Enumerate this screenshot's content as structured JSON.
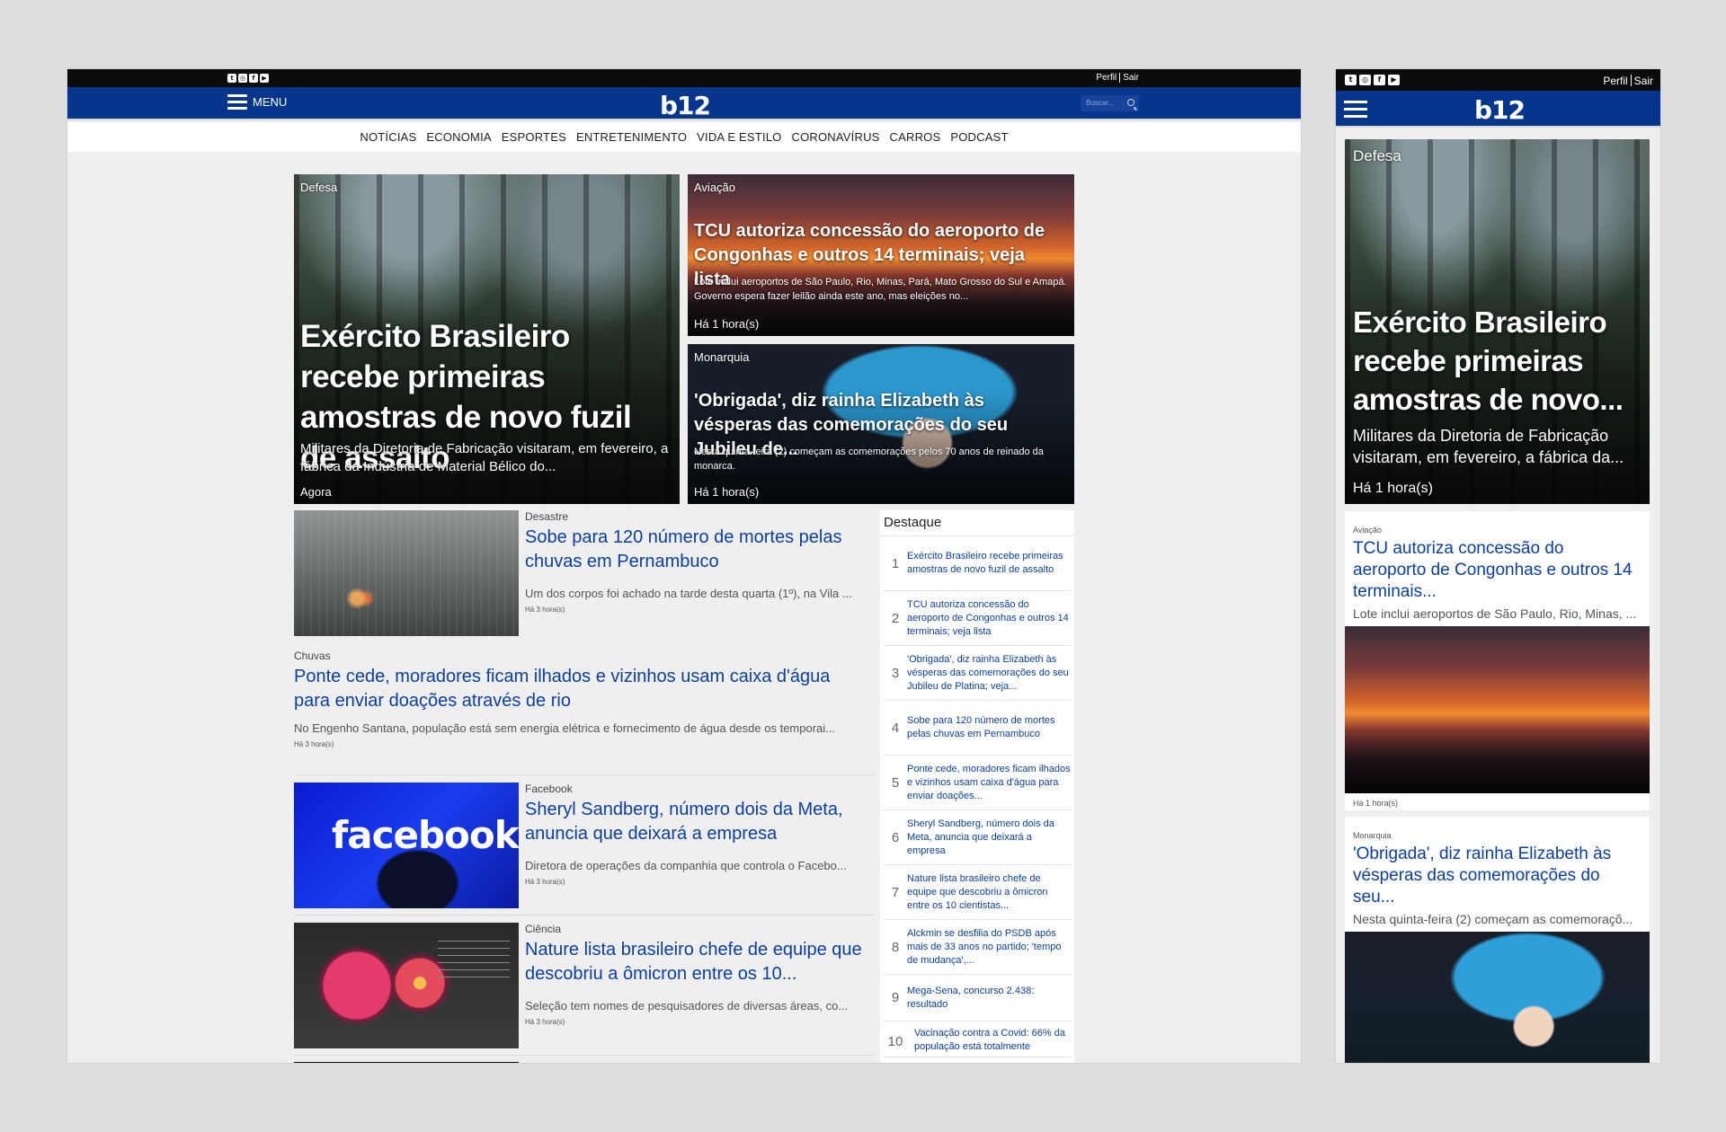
{
  "brand": {
    "logo": "b12"
  },
  "topbar": {
    "social": [
      "twitter-icon",
      "instagram-icon",
      "facebook-icon",
      "youtube-icon"
    ],
    "profile": "Perfil",
    "logout": "Sair"
  },
  "navbar": {
    "menu_label": "MENU",
    "search_placeholder": "Buscar..."
  },
  "categories": [
    "NOTÍCIAS",
    "ECONOMIA",
    "ESPORTES",
    "ENTRETENIMENTO",
    "VIDA E ESTILO",
    "CORONAVÍRUS",
    "CARROS",
    "PODCAST"
  ],
  "hero": {
    "main": {
      "category": "Defesa",
      "title": "Exército Brasileiro recebe primeiras amostras de novo fuzil de assalto",
      "summary": "Militares da Diretoria de Fabricação visitaram, em fevereiro, a fábrica da Indústria de Material Bélico do...",
      "time": "Agora"
    },
    "side1": {
      "category": "Aviação",
      "title": "TCU autoriza concessão do aeroporto de Congonhas e outros 14 terminais; veja lista",
      "summary": "Lote inclui aeroportos de São Paulo, Rio, Minas, Pará, Mato Grosso do Sul e Amapá. Governo espera fazer leilão ainda este ano, mas eleições no...",
      "time": "Há 1 hora(s)"
    },
    "side2": {
      "category": "Monarquia",
      "title": "'Obrigada', diz rainha Elizabeth às vésperas das comemorações do seu Jubileu de...",
      "summary": "Nesta quinta-feira (2) começam as comemorações pelos 70 anos de reinado da monarca.",
      "time": "Há 1 hora(s)"
    }
  },
  "articles": [
    {
      "category": "Desastre",
      "title": "Sobe para 120 número de mortes pelas chuvas em Pernambuco",
      "summary": "Um dos corpos foi achado na tarde desta quarta (1º), na Vila ...",
      "time": "Há 3 hora(s)"
    },
    {
      "category": "Chuvas",
      "title": "Ponte cede, moradores ficam ilhados e vizinhos usam caixa d'água para enviar doações através de rio",
      "summary": "No Engenho Santana, população está sem energia elétrica e fornecimento de água desde os temporai...",
      "time": "Há 3 hora(s)"
    },
    {
      "category": "Facebook",
      "title": "Sheryl Sandberg, número dois da Meta, anuncia que deixará a empresa",
      "summary": "Diretora de operações da companhia que controla o Facebo...",
      "time": "Há 3 hora(s)",
      "image_text": "facebook"
    },
    {
      "category": "Ciência",
      "title": "Nature lista brasileiro chefe de equipe que descobriu a ômicron entre os 10...",
      "summary": "Seleção tem nomes de pesquisadores de diversas áreas, co...",
      "time": "Há 3 hora(s)"
    }
  ],
  "highlights": {
    "heading": "Destaque",
    "items": [
      {
        "num": "1",
        "title": "Exército Brasileiro recebe primeiras amostras de novo fuzil de assalto"
      },
      {
        "num": "2",
        "title": "TCU autoriza concessão do aeroporto de Congonhas e outros 14 terminais; veja lista"
      },
      {
        "num": "3",
        "title": "'Obrigada', diz rainha Elizabeth às vésperas das comemorações do seu Jubileu de Platina; veja..."
      },
      {
        "num": "4",
        "title": "Sobe para 120 número de mortes pelas chuvas em Pernambuco"
      },
      {
        "num": "5",
        "title": "Ponte cede, moradores ficam ilhados e vizinhos usam caixa d'água para enviar doações..."
      },
      {
        "num": "6",
        "title": "Sheryl Sandberg, número dois da Meta, anuncia que deixará a empresa"
      },
      {
        "num": "7",
        "title": "Nature lista brasileiro chefe de equipe que descobriu a ômicron entre os 10 cientistas..."
      },
      {
        "num": "8",
        "title": "Alckmin se desfilia do PSDB após mais de 33 anos no partido; 'tempo de mudança',..."
      },
      {
        "num": "9",
        "title": "Mega-Sena, concurso 2.438: resultado"
      },
      {
        "num": "10",
        "title": "Vacinação contra a Covid: 66% da população está totalmente"
      }
    ]
  },
  "mobile": {
    "hero": {
      "category": "Defesa",
      "title": "Exército Brasileiro recebe primeiras amostras de novo...",
      "summary": "Militares da Diretoria de Fabricação visitaram, em fevereiro, a fábrica da...",
      "time": "Há 1 hora(s)"
    },
    "card1": {
      "category": "Aviação",
      "title": "TCU autoriza concessão do aeroporto de Congonhas e outros 14 terminais...",
      "summary": "Lote inclui aeroportos de São Paulo, Rio, Minas, ...",
      "time": "Há 1 hora(s)"
    },
    "card2": {
      "category": "Monarquia",
      "title": "'Obrigada', diz rainha Elizabeth às vésperas das comemorações do seu...",
      "summary": "Nesta quinta-feira (2) começam as comemoraçõ..."
    }
  }
}
